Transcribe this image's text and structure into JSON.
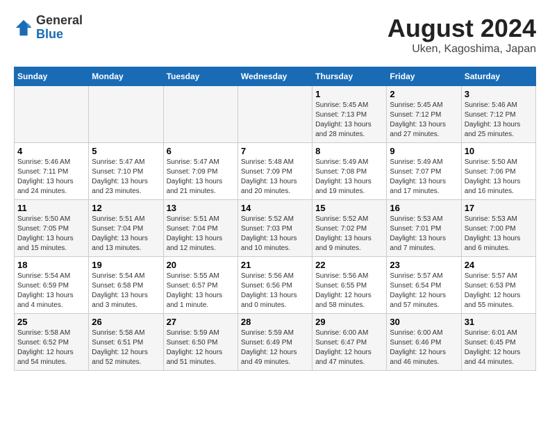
{
  "header": {
    "logo_general": "General",
    "logo_blue": "Blue",
    "title": "August 2024",
    "subtitle": "Uken, Kagoshima, Japan"
  },
  "days_of_week": [
    "Sunday",
    "Monday",
    "Tuesday",
    "Wednesday",
    "Thursday",
    "Friday",
    "Saturday"
  ],
  "weeks": [
    [
      {
        "num": "",
        "info": ""
      },
      {
        "num": "",
        "info": ""
      },
      {
        "num": "",
        "info": ""
      },
      {
        "num": "",
        "info": ""
      },
      {
        "num": "1",
        "info": "Sunrise: 5:45 AM\nSunset: 7:13 PM\nDaylight: 13 hours\nand 28 minutes."
      },
      {
        "num": "2",
        "info": "Sunrise: 5:45 AM\nSunset: 7:12 PM\nDaylight: 13 hours\nand 27 minutes."
      },
      {
        "num": "3",
        "info": "Sunrise: 5:46 AM\nSunset: 7:12 PM\nDaylight: 13 hours\nand 25 minutes."
      }
    ],
    [
      {
        "num": "4",
        "info": "Sunrise: 5:46 AM\nSunset: 7:11 PM\nDaylight: 13 hours\nand 24 minutes."
      },
      {
        "num": "5",
        "info": "Sunrise: 5:47 AM\nSunset: 7:10 PM\nDaylight: 13 hours\nand 23 minutes."
      },
      {
        "num": "6",
        "info": "Sunrise: 5:47 AM\nSunset: 7:09 PM\nDaylight: 13 hours\nand 21 minutes."
      },
      {
        "num": "7",
        "info": "Sunrise: 5:48 AM\nSunset: 7:09 PM\nDaylight: 13 hours\nand 20 minutes."
      },
      {
        "num": "8",
        "info": "Sunrise: 5:49 AM\nSunset: 7:08 PM\nDaylight: 13 hours\nand 19 minutes."
      },
      {
        "num": "9",
        "info": "Sunrise: 5:49 AM\nSunset: 7:07 PM\nDaylight: 13 hours\nand 17 minutes."
      },
      {
        "num": "10",
        "info": "Sunrise: 5:50 AM\nSunset: 7:06 PM\nDaylight: 13 hours\nand 16 minutes."
      }
    ],
    [
      {
        "num": "11",
        "info": "Sunrise: 5:50 AM\nSunset: 7:05 PM\nDaylight: 13 hours\nand 15 minutes."
      },
      {
        "num": "12",
        "info": "Sunrise: 5:51 AM\nSunset: 7:04 PM\nDaylight: 13 hours\nand 13 minutes."
      },
      {
        "num": "13",
        "info": "Sunrise: 5:51 AM\nSunset: 7:04 PM\nDaylight: 13 hours\nand 12 minutes."
      },
      {
        "num": "14",
        "info": "Sunrise: 5:52 AM\nSunset: 7:03 PM\nDaylight: 13 hours\nand 10 minutes."
      },
      {
        "num": "15",
        "info": "Sunrise: 5:52 AM\nSunset: 7:02 PM\nDaylight: 13 hours\nand 9 minutes."
      },
      {
        "num": "16",
        "info": "Sunrise: 5:53 AM\nSunset: 7:01 PM\nDaylight: 13 hours\nand 7 minutes."
      },
      {
        "num": "17",
        "info": "Sunrise: 5:53 AM\nSunset: 7:00 PM\nDaylight: 13 hours\nand 6 minutes."
      }
    ],
    [
      {
        "num": "18",
        "info": "Sunrise: 5:54 AM\nSunset: 6:59 PM\nDaylight: 13 hours\nand 4 minutes."
      },
      {
        "num": "19",
        "info": "Sunrise: 5:54 AM\nSunset: 6:58 PM\nDaylight: 13 hours\nand 3 minutes."
      },
      {
        "num": "20",
        "info": "Sunrise: 5:55 AM\nSunset: 6:57 PM\nDaylight: 13 hours\nand 1 minute."
      },
      {
        "num": "21",
        "info": "Sunrise: 5:56 AM\nSunset: 6:56 PM\nDaylight: 13 hours\nand 0 minutes."
      },
      {
        "num": "22",
        "info": "Sunrise: 5:56 AM\nSunset: 6:55 PM\nDaylight: 12 hours\nand 58 minutes."
      },
      {
        "num": "23",
        "info": "Sunrise: 5:57 AM\nSunset: 6:54 PM\nDaylight: 12 hours\nand 57 minutes."
      },
      {
        "num": "24",
        "info": "Sunrise: 5:57 AM\nSunset: 6:53 PM\nDaylight: 12 hours\nand 55 minutes."
      }
    ],
    [
      {
        "num": "25",
        "info": "Sunrise: 5:58 AM\nSunset: 6:52 PM\nDaylight: 12 hours\nand 54 minutes."
      },
      {
        "num": "26",
        "info": "Sunrise: 5:58 AM\nSunset: 6:51 PM\nDaylight: 12 hours\nand 52 minutes."
      },
      {
        "num": "27",
        "info": "Sunrise: 5:59 AM\nSunset: 6:50 PM\nDaylight: 12 hours\nand 51 minutes."
      },
      {
        "num": "28",
        "info": "Sunrise: 5:59 AM\nSunset: 6:49 PM\nDaylight: 12 hours\nand 49 minutes."
      },
      {
        "num": "29",
        "info": "Sunrise: 6:00 AM\nSunset: 6:47 PM\nDaylight: 12 hours\nand 47 minutes."
      },
      {
        "num": "30",
        "info": "Sunrise: 6:00 AM\nSunset: 6:46 PM\nDaylight: 12 hours\nand 46 minutes."
      },
      {
        "num": "31",
        "info": "Sunrise: 6:01 AM\nSunset: 6:45 PM\nDaylight: 12 hours\nand 44 minutes."
      }
    ]
  ]
}
